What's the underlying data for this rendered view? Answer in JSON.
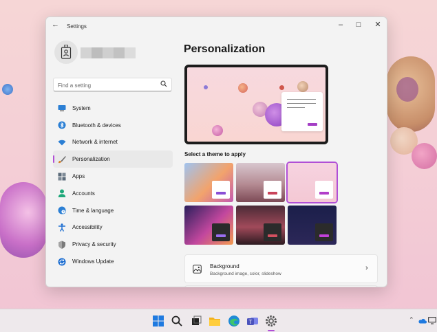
{
  "window": {
    "title": "Settings"
  },
  "sidebar": {
    "search_placeholder": "Find a setting",
    "items": [
      {
        "label": "System",
        "icon": "system-monitor-icon",
        "color": "#2b7fd4"
      },
      {
        "label": "Bluetooth & devices",
        "icon": "bluetooth-icon",
        "color": "#2b7fd4"
      },
      {
        "label": "Network & internet",
        "icon": "wifi-icon",
        "color": "#2b7fd4"
      },
      {
        "label": "Personalization",
        "icon": "paintbrush-icon",
        "color": "#d9822b",
        "selected": true
      },
      {
        "label": "Apps",
        "icon": "apps-grid-icon",
        "color": "#5b6b7a"
      },
      {
        "label": "Accounts",
        "icon": "person-icon",
        "color": "#1ea87a"
      },
      {
        "label": "Time & language",
        "icon": "globe-clock-icon",
        "color": "#2b7fd4"
      },
      {
        "label": "Accessibility",
        "icon": "accessibility-icon",
        "color": "#1f6fd1"
      },
      {
        "label": "Privacy & security",
        "icon": "shield-icon",
        "color": "#6a6a6a"
      },
      {
        "label": "Windows Update",
        "icon": "update-arrows-icon",
        "color": "#1f6fd1"
      }
    ]
  },
  "main": {
    "title": "Personalization",
    "theme_heading": "Select a theme to apply",
    "themes": [
      {
        "name": "glow-light",
        "bg": "linear-gradient(135deg,#9fc3f0,#f2a36c 55%,#c45ab0)",
        "card": "#ffffff",
        "button": "#8a4fd6",
        "selected": false
      },
      {
        "name": "captured-motion-light",
        "bg": "linear-gradient(180deg,#d8c7cf,#b48a92 55%,#7d4a56)",
        "card": "#ffffff",
        "button": "#c9445a",
        "selected": false
      },
      {
        "name": "sun-valley-light",
        "bg": "linear-gradient(180deg,#f6d3e0,#f4c8d4)",
        "card": "#ffffff",
        "button": "#b13ec9",
        "selected": true
      },
      {
        "name": "glow-dark",
        "bg": "linear-gradient(135deg,#2a1f5c,#c2479e 55%,#f39a4f)",
        "card": "#2b2b2b",
        "button": "#9a6ef0",
        "selected": false
      },
      {
        "name": "captured-motion-dark",
        "bg": "linear-gradient(180deg,#4a2a36,#a14a5a 55%,#2c1a20)",
        "card": "#2b2b2b",
        "button": "#d2505f",
        "selected": false
      },
      {
        "name": "sun-valley-dark",
        "bg": "linear-gradient(180deg,#1b1f4a,#2c2758)",
        "card": "#2b2b2b",
        "button": "#c140d8",
        "selected": false
      }
    ],
    "background": {
      "title": "Background",
      "subtitle": "Background image, color, slideshow"
    }
  },
  "accent_color": "#b14fd6",
  "taskbar": {
    "icons": [
      "windows-start-icon",
      "search-icon",
      "task-view-icon",
      "file-explorer-icon",
      "edge-browser-icon",
      "teams-icon",
      "settings-gear-icon"
    ],
    "tray": [
      "chevron-up-icon",
      "onedrive-cloud-icon",
      "monitor-icon"
    ]
  }
}
